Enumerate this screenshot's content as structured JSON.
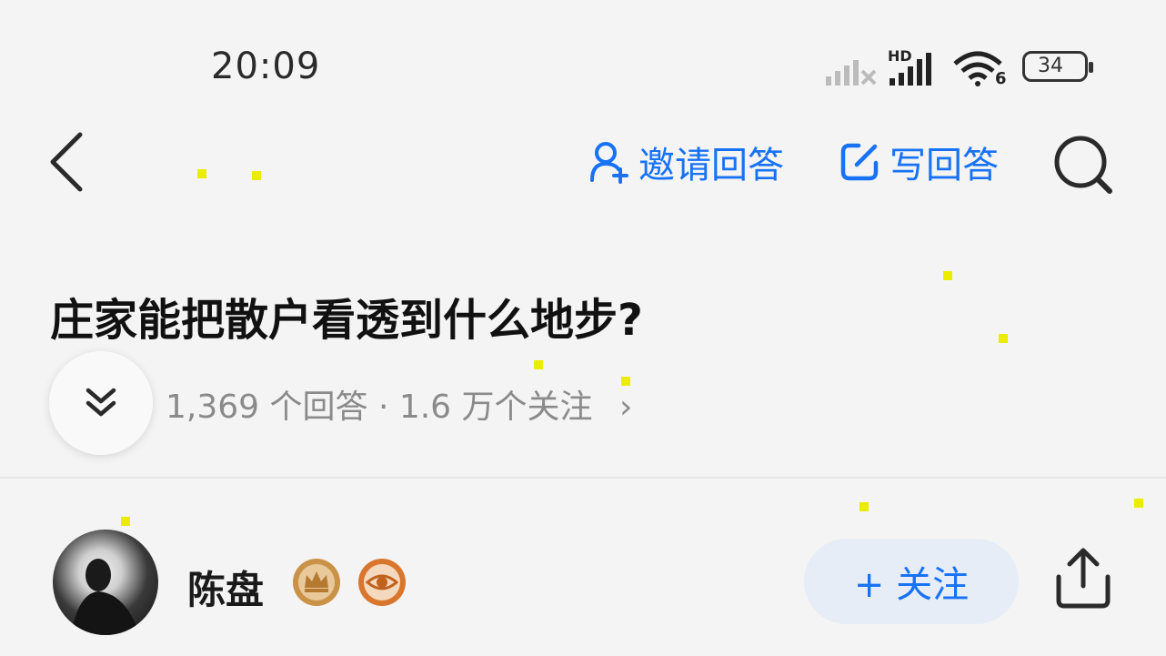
{
  "status_bar": {
    "time": "20:09",
    "battery": "34",
    "hd_label": "HD",
    "wifi_label": "6"
  },
  "nav": {
    "invite_label": "邀请回答",
    "write_label": "写回答"
  },
  "question": {
    "title": "庄家能把散户看透到什么地步?",
    "stats": "1,369 个回答 · 1.6 万个关注",
    "arrow": "›"
  },
  "author": {
    "name": "陈盘",
    "follow_label": "+ 关注"
  },
  "colors": {
    "accent": "#1772f6",
    "text": "#1a1a1a",
    "muted": "#8a8a8a",
    "follow_bg": "#e6edf7",
    "badge_gold": "#c99247",
    "badge_orange": "#d9762d"
  },
  "icons": [
    "back-arrow-icon",
    "invite-user-icon",
    "write-icon",
    "search-icon",
    "expand-chevron-icon",
    "crown-badge-icon",
    "eye-badge-icon",
    "share-icon"
  ]
}
